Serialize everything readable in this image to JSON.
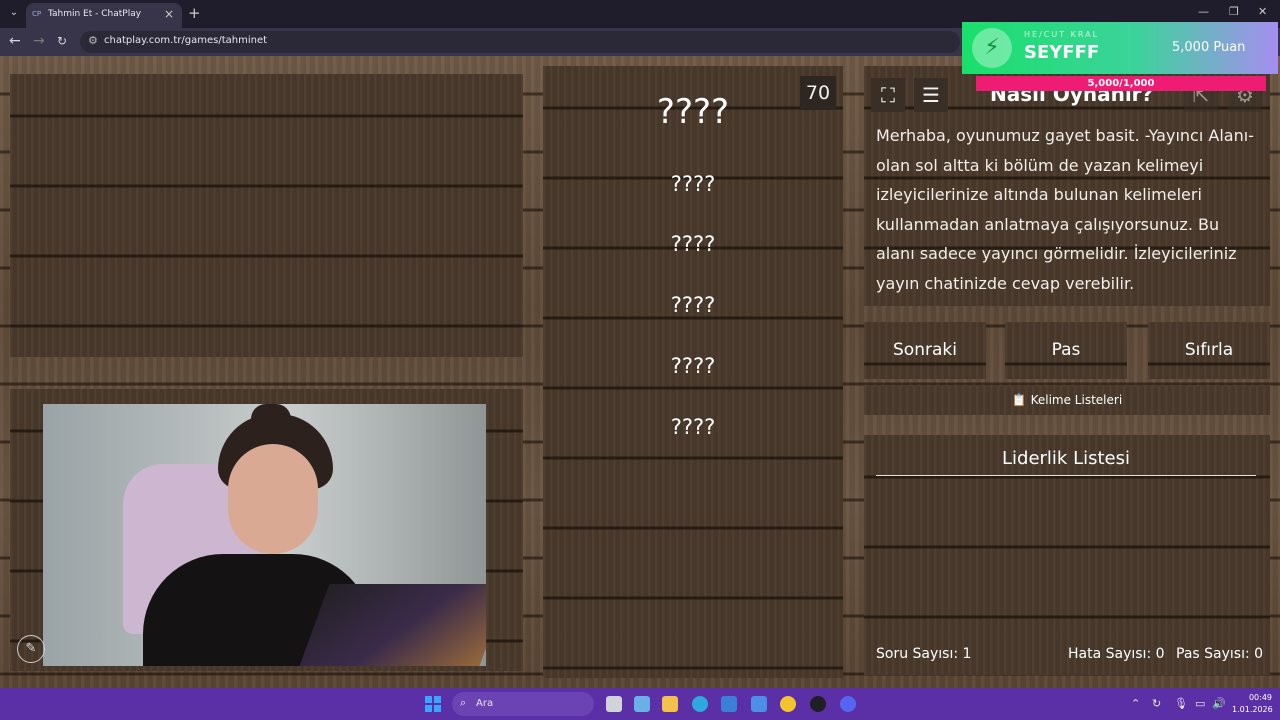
{
  "browser": {
    "tab_title": "Tahmin Et - ChatPlay",
    "tab_favicon": "CP",
    "url": "chatplay.com.tr/games/tahminet"
  },
  "game": {
    "timer": "70",
    "main_word": "????",
    "forbidden_words": [
      "????",
      "????",
      "????",
      "????",
      "????"
    ],
    "howto_title": "Nasıl Oynanır?",
    "howto_text": "Merhaba, oyunumuz gayet basit. -Yayıncı Alanı- olan sol altta ki bölüm de yazan kelimeyi izleyicilerinize altında bulunan kelimeleri kullanmadan anlatmaya çalışıyorsunuz. Bu alanı sadece yayıncı görmelidir. İzleyicileriniz yayın chatinizde cevap verebilir.",
    "buttons": {
      "next": "Sonraki",
      "pass": "Pas",
      "reset": "Sıfırla"
    },
    "word_lists_label": "📋 Kelime Listeleri",
    "leaderboard_title": "Liderlik Listesi",
    "stats": {
      "questions": "Soru Sayısı: 1",
      "errors": "Hata Sayısı: 0",
      "passes": "Pas Sayısı: 0"
    }
  },
  "overlay": {
    "label": "HE/CUT KRAL",
    "name": "SEYFFF",
    "points": "5,000 Puan",
    "progress": "5,000/1,000"
  },
  "taskbar": {
    "search_placeholder": "Ara",
    "time": "00:49",
    "date": "1.01.2026"
  },
  "colors": {
    "wood_dark": "#4a3a2c",
    "overlay_green": "#19e06a",
    "progress_pink": "#ef1c74",
    "taskbar_purple": "#5b2fa6"
  }
}
